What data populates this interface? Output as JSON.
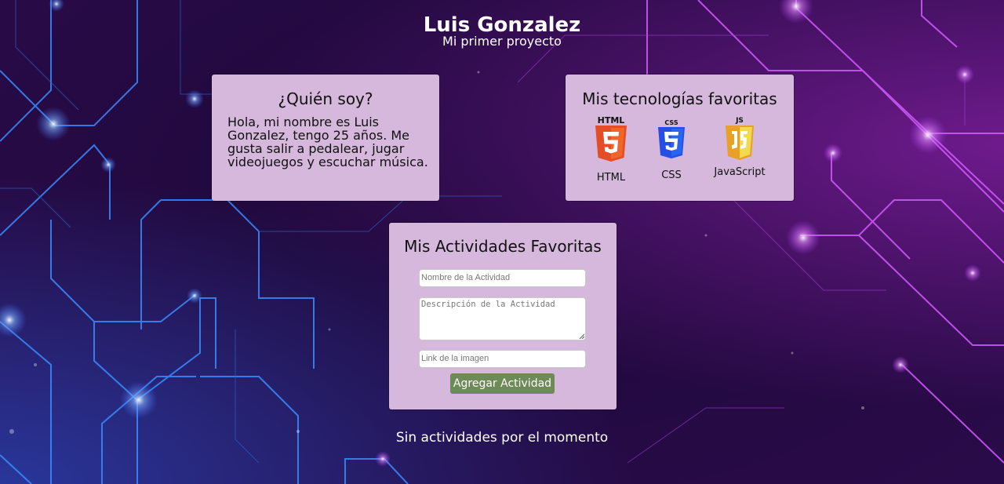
{
  "header": {
    "name": "Luis Gonzalez",
    "subtitle": "Mi primer proyecto"
  },
  "about": {
    "title": "¿Quién soy?",
    "text": "Hola, mi nombre es Luis Gonzalez, tengo 25 años. Me gusta salir a pedalear, jugar videojuegos y escuchar música."
  },
  "tech": {
    "title": "Mis tecnologías favoritas",
    "items": [
      {
        "label": "HTML",
        "logo_text": "HTML",
        "icon": "html5-icon",
        "color": "#e44d26"
      },
      {
        "label": "CSS",
        "logo_text": "CSS",
        "icon": "css3-icon",
        "color": "#264de4"
      },
      {
        "label": "JavaScript",
        "logo_text": "JS",
        "icon": "javascript-icon",
        "color": "#f0db4f"
      }
    ]
  },
  "activities": {
    "title": "Mis Actividades Favoritas",
    "name_placeholder": "Nombre de la Actividad",
    "name_value": "",
    "description_placeholder": "Descripción de la Actividad",
    "description_value": "",
    "image_placeholder": "Link de la imagen",
    "image_value": "",
    "submit_label": "Agregar Actividad",
    "submit_color": "#6e8a57",
    "empty_message": "Sin actividades por el momento"
  },
  "theme": {
    "card_bg": "#d5b8db",
    "bg_dark": "#22093f",
    "circuit_blue": "#3a8cff",
    "circuit_pink": "#d35bff"
  }
}
